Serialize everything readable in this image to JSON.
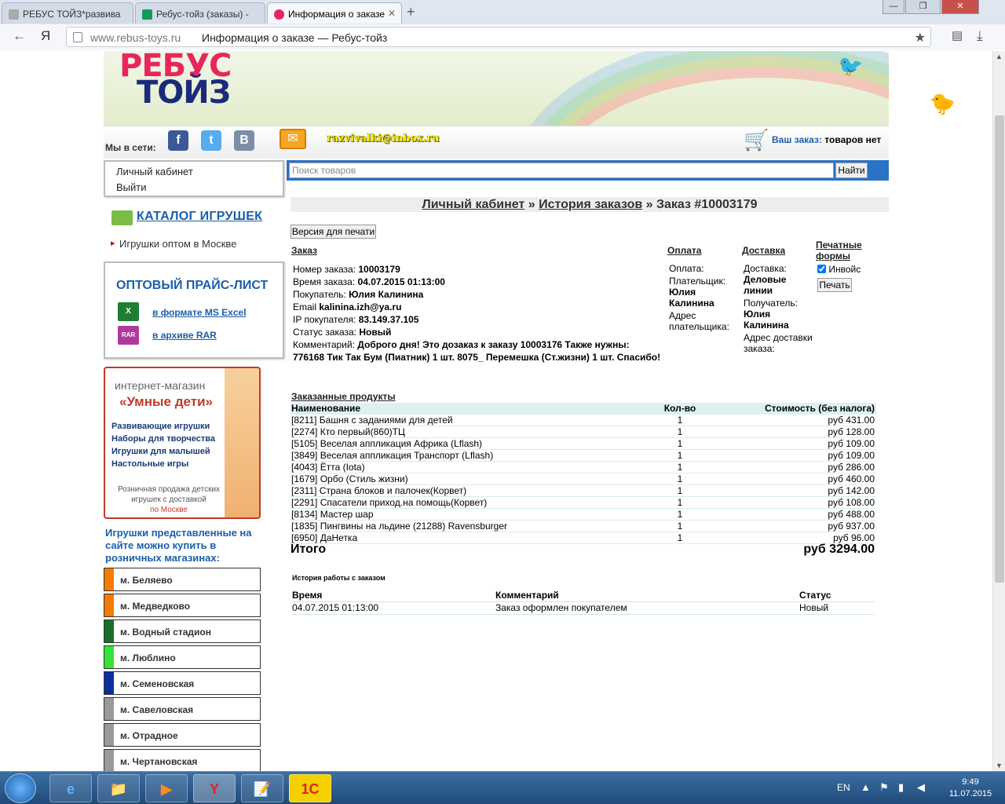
{
  "browser": {
    "tabs": [
      {
        "label": "РЕБУС ТОЙЗ*развива",
        "icon": "page-icon"
      },
      {
        "label": "Ребус-тойз (заказы) -",
        "icon": "sheets-icon"
      },
      {
        "label": "Информация о заказе",
        "icon": "rebus-favicon"
      }
    ],
    "new_tab": "+",
    "window_buttons": [
      "—",
      "❐",
      "✕"
    ],
    "back": "←",
    "yandex_logo": "Я",
    "url_host": "www.rebus-toys.ru",
    "url_title": "Информация о заказе — Ребус-тойз",
    "star": "★",
    "download": "⤓"
  },
  "site": {
    "logo_top": "РЕБУС",
    "logo_bottom": "ТОЙЗ",
    "social_label": "Мы в сети:",
    "social": [
      "f",
      "t",
      "B"
    ],
    "email": "razvivalki@inbox.ru",
    "cart_label": "Ваш заказ:",
    "cart_value": "товаров нет",
    "search_placeholder": "Поиск товаров",
    "search_button": "Найти",
    "account_links": [
      "Личный кабинет",
      "Выйти"
    ],
    "catalog_title": "КАТАЛОГ ИГРУШЕК",
    "wholesale_link": "Игрушки оптом в Москве",
    "price_list": {
      "title": "ОПТОВЫЙ ПРАЙС-ЛИСТ",
      "excel": "в формате MS Excel",
      "rar": "в архиве RAR",
      "excel_icon": "X",
      "rar_icon": "RAR"
    },
    "banner": {
      "line1": "интернет-магазин",
      "line2": "«Умные дети»",
      "items": [
        "Развивающие игрушки",
        "Наборы для творчества",
        "Игрушки для малышей",
        "Настольные игры"
      ],
      "footer": "Розничная продажа детских игрушек с доставкой",
      "footer_city": "по Москве"
    },
    "shops_title": "Игрушки представленные на сайте можно купить в розничных магазинах:",
    "shops": [
      {
        "name": "м. Беляево",
        "color": "#f57c00"
      },
      {
        "name": "м. Медведково",
        "color": "#f57c00"
      },
      {
        "name": "м. Водный стадион",
        "color": "#1b6e2a"
      },
      {
        "name": "м. Люблино",
        "color": "#35e535"
      },
      {
        "name": "м. Семеновская",
        "color": "#0d2f9e"
      },
      {
        "name": "м. Савеловская",
        "color": "#9a9a9a"
      },
      {
        "name": "м. Отрадное",
        "color": "#9a9a9a"
      },
      {
        "name": "м. Чертановская",
        "color": "#9a9a9a"
      }
    ]
  },
  "order": {
    "breadcrumb": {
      "cabinet": "Личный кабинет",
      "sep1": "»",
      "history": "История заказов",
      "sep2": "»",
      "current": "Заказ #10003179"
    },
    "print_version": "Версия для печати",
    "sections": {
      "order": "Заказ",
      "payment": "Оплата",
      "delivery": "Доставка",
      "forms": "Печатные формы"
    },
    "fields": {
      "number_label": "Номер заказа:",
      "number": "10003179",
      "time_label": "Время заказа:",
      "time": "04.07.2015 01:13:00",
      "buyer_label": "Покупатель:",
      "buyer": "Юлия Калинина",
      "email_label": "Email",
      "email": "kalinina.izh@ya.ru",
      "ip_label": "IP покупателя:",
      "ip": "83.149.37.105",
      "status_label": "Статус заказа:",
      "status": "Новый",
      "comment_label": "Комментарий:",
      "comment": "Доброго дня! Это дозаказ к заказу 10003176 Также нужны: 776168 Тик Так Бум (Пиатник) 1 шт. 8075_ Перемешка (Ст.жизни) 1 шт. Спасибо!"
    },
    "payment": {
      "payment_label": "Оплата:",
      "payer_label": "Плательщик:",
      "payer": "Юлия Калинина",
      "payer_address_label": "Адрес плательщика:"
    },
    "delivery": {
      "delivery_label": "Доставка:",
      "delivery": "Деловые линии",
      "recipient_label": "Получатель:",
      "recipient": "Юлия Калинина",
      "address_label": "Адрес доставки заказа:"
    },
    "forms": {
      "invoice_label": "Инвойс",
      "invoice_checked": true,
      "print_button": "Печать"
    },
    "products_title": "Заказанные продукты",
    "columns": {
      "name": "Наименование",
      "qty": "Кол-во",
      "cost": "Стоимость (без налога)"
    },
    "products": [
      {
        "name": "[8211] Башня с заданиями для детей",
        "qty": "1",
        "cost": "руб 431.00"
      },
      {
        "name": "[2274] Кто первый(860)ТЦ",
        "qty": "1",
        "cost": "руб 128.00"
      },
      {
        "name": "[5105] Веселая аппликация Африка (Lflash)",
        "qty": "1",
        "cost": "руб 109.00"
      },
      {
        "name": "[3849] Веселая аппликация Транспорт (Lflash)",
        "qty": "1",
        "cost": "руб 109.00"
      },
      {
        "name": "[4043] Ётта (Iota)",
        "qty": "1",
        "cost": "руб 286.00"
      },
      {
        "name": "[1679] Орбо (Стиль жизни)",
        "qty": "1",
        "cost": "руб 460.00"
      },
      {
        "name": "[2311] Страна блоков и палочек(Корвет)",
        "qty": "1",
        "cost": "руб 142.00"
      },
      {
        "name": "[2291] Спасатели приход.на помощь(Корвет)",
        "qty": "1",
        "cost": "руб 108.00"
      },
      {
        "name": "[8134] Мастер шар",
        "qty": "1",
        "cost": "руб 488.00"
      },
      {
        "name": "[1835] Пингвины на льдине (21288) Ravensburger",
        "qty": "1",
        "cost": "руб 937.00"
      },
      {
        "name": "[6950] ДаНетка",
        "qty": "1",
        "cost": "руб 96.00"
      }
    ],
    "total_label": "Итого",
    "total_value": "руб 3294.00",
    "history": {
      "caption": "История работы с заказом",
      "col_time": "Время",
      "col_comment": "Комментарий",
      "col_status": "Статус",
      "rows": [
        {
          "time": "04.07.2015 01:13:00",
          "comment": "Заказ оформлен покупателем",
          "status": "Новый"
        }
      ]
    }
  },
  "taskbar": {
    "apps": [
      "e",
      "📁",
      "▶",
      "Y",
      "📝",
      "1С"
    ],
    "lang": "EN",
    "time": "9:49",
    "date": "11.07.2015"
  }
}
